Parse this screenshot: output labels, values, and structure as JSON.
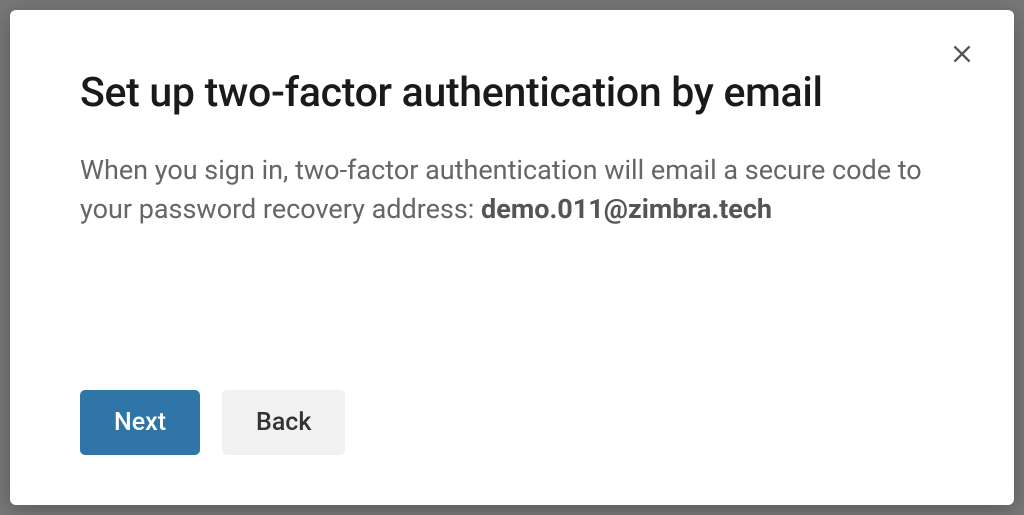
{
  "dialog": {
    "title": "Set up two-factor authentication by email",
    "description_prefix": "When you sign in, two-factor authentication will email a secure code to your password recovery address: ",
    "recovery_email": "demo.011@zimbra.tech",
    "buttons": {
      "next": "Next",
      "back": "Back"
    }
  }
}
